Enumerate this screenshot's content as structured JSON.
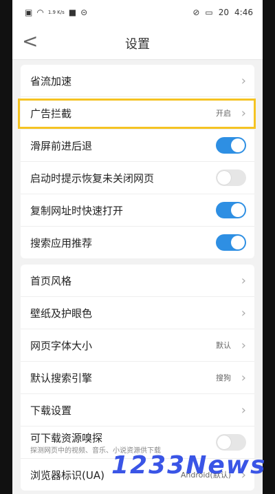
{
  "status": {
    "speed": "1.9\nK/s",
    "battery": "20",
    "time": "4:46"
  },
  "header": {
    "title": "设置",
    "back": "<"
  },
  "group1": [
    {
      "label": "省流加速",
      "type": "nav"
    },
    {
      "label": "广告拦截",
      "type": "nav",
      "value": "开启"
    },
    {
      "label": "滑屏前进后退",
      "type": "toggle",
      "on": true
    },
    {
      "label": "启动时提示恢复未关闭网页",
      "type": "toggle",
      "on": false
    },
    {
      "label": "复制网址时快速打开",
      "type": "toggle",
      "on": true
    },
    {
      "label": "搜索应用推荐",
      "type": "toggle",
      "on": true
    }
  ],
  "group2": [
    {
      "label": "首页风格",
      "type": "nav"
    },
    {
      "label": "壁纸及护眼色",
      "type": "nav"
    },
    {
      "label": "网页字体大小",
      "type": "nav",
      "value": "默认"
    },
    {
      "label": "默认搜索引擎",
      "type": "nav",
      "value": "搜狗"
    },
    {
      "label": "下载设置",
      "type": "nav"
    },
    {
      "label": "可下载资源嗅探",
      "type": "toggle",
      "on": false,
      "subtitle": "探测网页中的视频、音乐、小说资源供下载"
    },
    {
      "label": "浏览器标识(UA)",
      "type": "nav",
      "value": "Android(默认)"
    }
  ],
  "watermark": "1233News",
  "colors": {
    "accent": "#2e8fe3",
    "highlight": "#f5c322"
  }
}
